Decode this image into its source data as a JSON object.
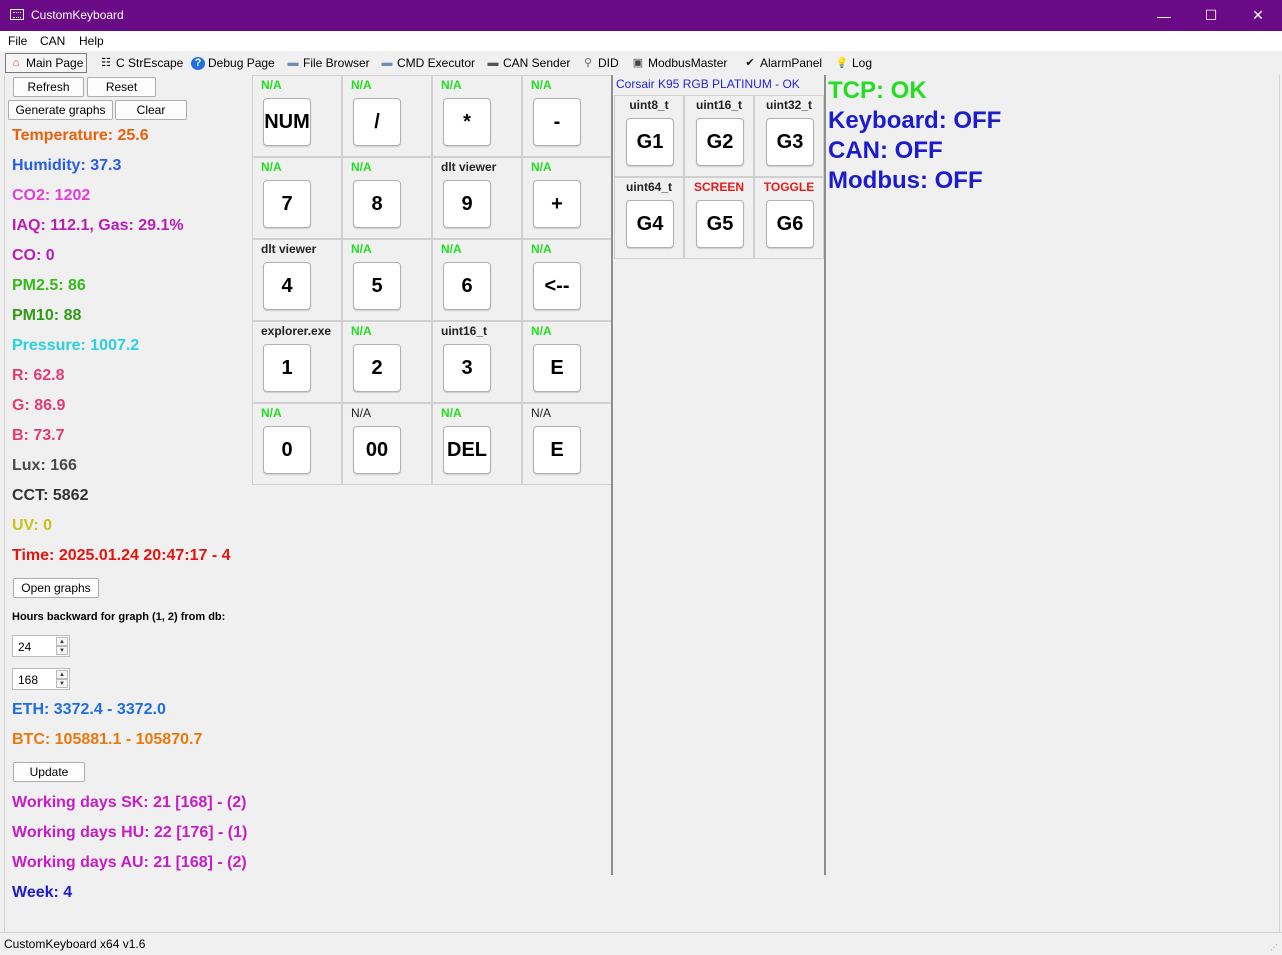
{
  "window": {
    "title": "CustomKeyboard",
    "minimize": "—",
    "maximize": "☐",
    "close": "✕"
  },
  "menu": [
    "File",
    "CAN",
    "Help"
  ],
  "tabs": [
    {
      "label": "Main Page",
      "icon": "home-icon",
      "glyph": "⌂"
    },
    {
      "label": "C StrEscape",
      "icon": "list-icon",
      "glyph": "☷"
    },
    {
      "label": "Debug Page",
      "icon": "help-icon",
      "glyph": "?"
    },
    {
      "label": "File Browser",
      "icon": "folder-icon",
      "glyph": "▬"
    },
    {
      "label": "CMD Executor",
      "icon": "folder-icon",
      "glyph": "▬"
    },
    {
      "label": "CAN Sender",
      "icon": "cable-icon",
      "glyph": "▬"
    },
    {
      "label": "DID",
      "icon": "magnifier-icon",
      "glyph": "⚲"
    },
    {
      "label": "ModbusMaster",
      "icon": "printer-icon",
      "glyph": "▣"
    },
    {
      "label": "AlarmPanel",
      "icon": "check-icon",
      "glyph": "✔"
    },
    {
      "label": "Log",
      "icon": "lightbulb-icon",
      "glyph": "💡"
    }
  ],
  "buttons": {
    "refresh": "Refresh",
    "reset": "Reset",
    "generate_graphs": "Generate graphs",
    "clear": "Clear",
    "open_graphs": "Open graphs",
    "update": "Update"
  },
  "sensors": [
    {
      "text": "Temperature: 25.6",
      "color": "#e8620e"
    },
    {
      "text": "Humidity: 37.3",
      "color": "#2a5ee0"
    },
    {
      "text": "CO2: 1202",
      "color": "#e13fd9"
    },
    {
      "text": "IAQ: 112.1, Gas: 29.1%",
      "color": "#b81eb4"
    },
    {
      "text": "CO: 0",
      "color": "#b81eb4"
    },
    {
      "text": "PM2.5: 86",
      "color": "#37b91e"
    },
    {
      "text": "PM10: 88",
      "color": "#2f9a14"
    },
    {
      "text": "Pressure: 1007.2",
      "color": "#2ad1e0"
    },
    {
      "text": "R: 62.8",
      "color": "#e23b78"
    },
    {
      "text": "G: 86.9",
      "color": "#e23b78"
    },
    {
      "text": "B: 73.7",
      "color": "#e23b78"
    },
    {
      "text": "Lux: 166",
      "color": "#4a4a4a"
    },
    {
      "text": "CCT: 5862",
      "color": "#333333"
    },
    {
      "text": "UV: 0",
      "color": "#c9c21a"
    },
    {
      "text": "Time: 2025.01.24 20:47:17 - 4",
      "color": "#e4150f"
    }
  ],
  "graph_hours_label": "Hours backward for graph (1, 2) from db:",
  "spin1": "24",
  "spin2": "168",
  "crypto": [
    {
      "text": "ETH: 3372.4 - 3372.0",
      "color": "#1f6ee0"
    },
    {
      "text": "BTC: 105881.1 - 105870.7",
      "color": "#e8790e"
    }
  ],
  "workdays": [
    {
      "text": "Working days SK: 21 [168] - (2)",
      "color": "#c41ec4"
    },
    {
      "text": "Working days HU: 22 [176] - (1)",
      "color": "#c41ec4"
    },
    {
      "text": "Working days AU: 21 [168] - (2)",
      "color": "#c41ec4"
    },
    {
      "text": "Week: 4",
      "color": "#1b1bcf"
    }
  ],
  "keypad": [
    {
      "label": "N/A",
      "lc": "#22dd22",
      "key": "NUM"
    },
    {
      "label": "N/A",
      "lc": "#22dd22",
      "key": "/"
    },
    {
      "label": "N/A",
      "lc": "#22dd22",
      "key": "*"
    },
    {
      "label": "N/A",
      "lc": "#22dd22",
      "key": "-"
    },
    {
      "label": "N/A",
      "lc": "#22dd22",
      "key": "7"
    },
    {
      "label": "N/A",
      "lc": "#22dd22",
      "key": "8"
    },
    {
      "label": "dlt viewer",
      "lc": "#222222",
      "key": "9"
    },
    {
      "label": "N/A",
      "lc": "#22dd22",
      "key": "+"
    },
    {
      "label": "dlt viewer",
      "lc": "#222222",
      "key": "4"
    },
    {
      "label": "N/A",
      "lc": "#22dd22",
      "key": "5"
    },
    {
      "label": "N/A",
      "lc": "#22dd22",
      "key": "6"
    },
    {
      "label": "N/A",
      "lc": "#22dd22",
      "key": "<--"
    },
    {
      "label": "explorer.exe",
      "lc": "#222222",
      "key": "1"
    },
    {
      "label": "N/A",
      "lc": "#22dd22",
      "key": "2"
    },
    {
      "label": "uint16_t",
      "lc": "#222222",
      "key": "3"
    },
    {
      "label": "N/A",
      "lc": "#22dd22",
      "key": "E"
    },
    {
      "label": "N/A",
      "lc": "#22dd22",
      "key": "0"
    },
    {
      "label": "N/A",
      "lc": "#222222",
      "key": "00"
    },
    {
      "label": "N/A",
      "lc": "#22dd22",
      "key": "DEL"
    },
    {
      "label": "N/A",
      "lc": "#222222",
      "key": "E"
    }
  ],
  "keyboard_status": "Corsair K95 RGB PLATINUM - OK",
  "gkeys": [
    {
      "label": "uint8_t",
      "lc": "#222222",
      "key": "G1"
    },
    {
      "label": "uint16_t",
      "lc": "#222222",
      "key": "G2"
    },
    {
      "label": "uint32_t",
      "lc": "#222222",
      "key": "G3"
    },
    {
      "label": "uint64_t",
      "lc": "#222222",
      "key": "G4"
    },
    {
      "label": "SCREEN",
      "lc": "#e41b1b",
      "key": "G5"
    },
    {
      "label": "TOGGLE",
      "lc": "#e41b1b",
      "key": "G6"
    }
  ],
  "connections": [
    {
      "text": "TCP: OK",
      "color": "#22dd22"
    },
    {
      "text": "Keyboard: OFF",
      "color": "#1b1bcf"
    },
    {
      "text": "CAN: OFF",
      "color": "#1b1bcf"
    },
    {
      "text": "Modbus: OFF",
      "color": "#1b1bcf"
    }
  ],
  "statusbar": "CustomKeyboard x64 v1.6"
}
